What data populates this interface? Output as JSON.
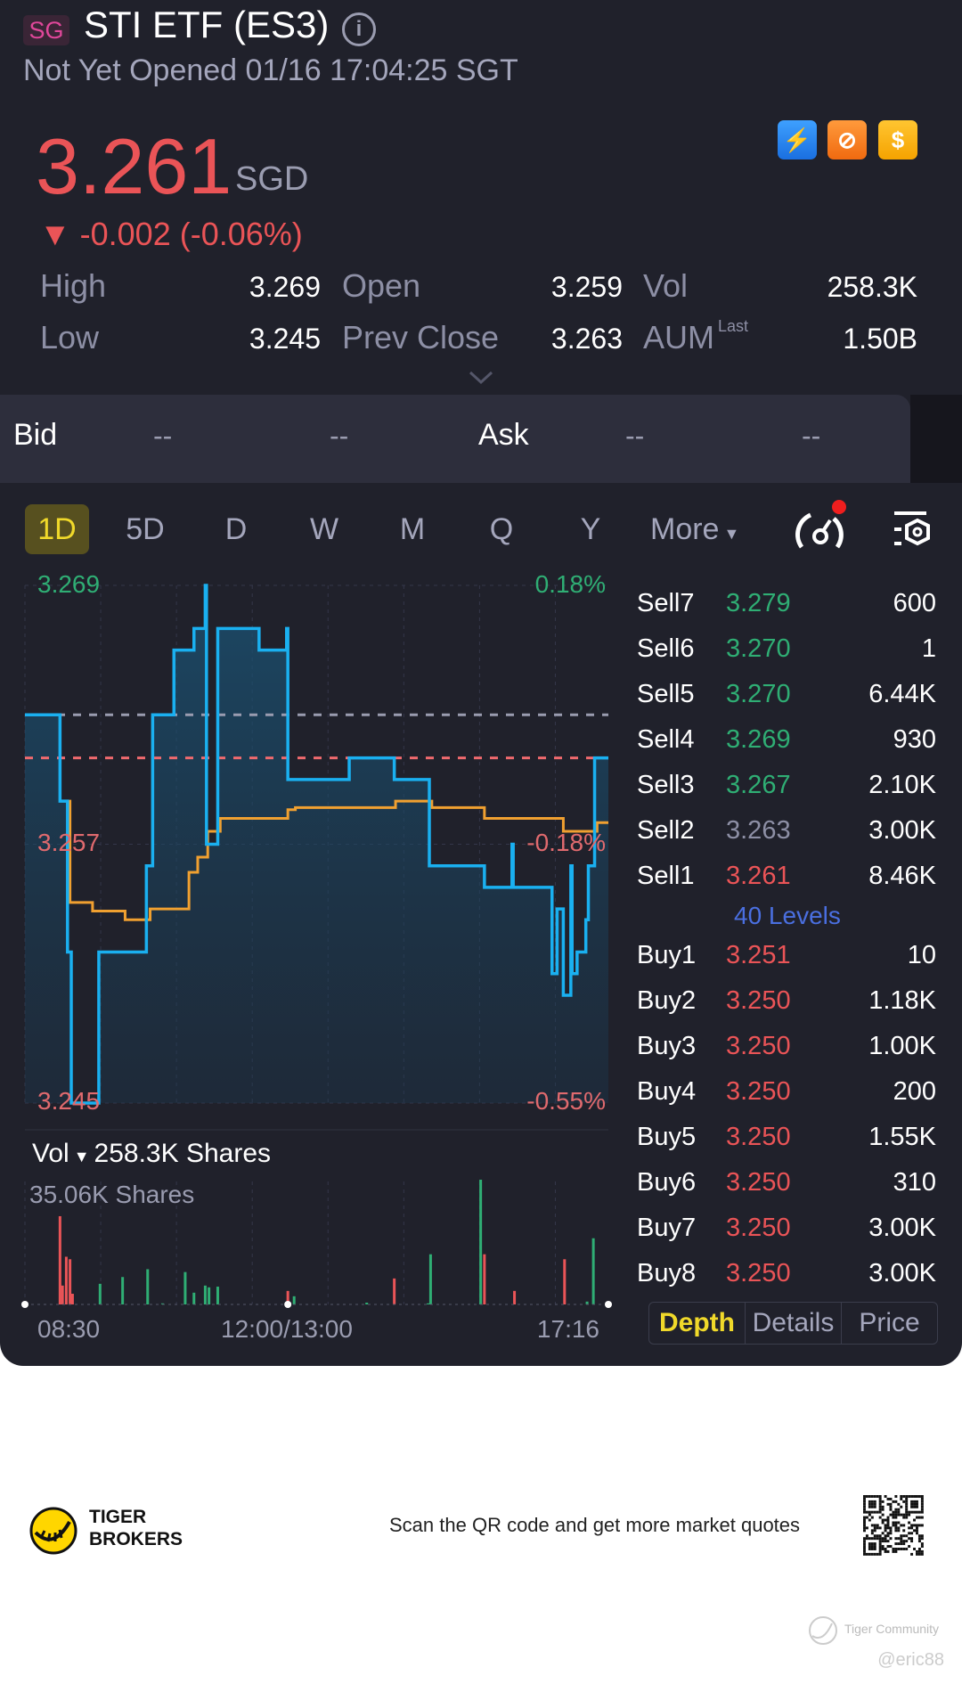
{
  "header": {
    "market_badge": "SG",
    "title": "STI ETF (ES3)",
    "info_icon": "info-icon",
    "status": "Not Yet Opened 01/16 17:04:25 SGT"
  },
  "quote": {
    "price": "3.261",
    "currency": "SGD",
    "change": "▼ -0.002 (-0.06%)",
    "feature_icons": [
      "level2-lightning-icon",
      "options-icon",
      "dollar-icon"
    ]
  },
  "stats": [
    {
      "label": "High",
      "value": "3.269"
    },
    {
      "label": "Open",
      "value": "3.259"
    },
    {
      "label": "Vol",
      "value": "258.3K"
    },
    {
      "label": "Low",
      "value": "3.245"
    },
    {
      "label": "Prev Close",
      "value": "3.263"
    },
    {
      "label": "AUM",
      "sup": "Last",
      "value": "1.50B"
    }
  ],
  "bidask": {
    "bid_label": "Bid",
    "bid_price": "--",
    "bid_size": "--",
    "ask_label": "Ask",
    "ask_price": "--",
    "ask_size": "--"
  },
  "periods": [
    "1D",
    "5D",
    "D",
    "W",
    "M",
    "Q",
    "Y",
    "More"
  ],
  "active_period": "1D",
  "colors": {
    "up": "#2fae74",
    "down": "#ea5457",
    "price_line": "#1ab0f0",
    "avg_line": "#f0a030",
    "accent": "#f0d92a"
  },
  "chart_data": {
    "type": "line",
    "ylim": [
      3.245,
      3.269
    ],
    "y_labels": {
      "top": "3.269",
      "mid": "3.257",
      "bottom": "3.245"
    },
    "pct_labels": {
      "top": "0.18%",
      "mid": "-0.18%",
      "bottom": "-0.55%"
    },
    "prev_close": 3.263,
    "last_price": 3.261,
    "x_labels": [
      "08:30",
      "12:00/13:00",
      "17:16"
    ],
    "price_series": [
      [
        "08:30",
        3.263
      ],
      [
        "08:58",
        3.259
      ],
      [
        "09:04",
        3.252
      ],
      [
        "09:07",
        3.245
      ],
      [
        "09:29",
        3.252
      ],
      [
        "10:07",
        3.256
      ],
      [
        "10:12",
        3.263
      ],
      [
        "10:29",
        3.266
      ],
      [
        "10:45",
        3.267
      ],
      [
        "10:54",
        3.269
      ],
      [
        "10:55",
        3.257
      ],
      [
        "11:04",
        3.267
      ],
      [
        "11:37",
        3.266
      ],
      [
        "11:59",
        3.267
      ],
      [
        "13:00",
        3.26
      ],
      [
        "13:49",
        3.261
      ],
      [
        "14:25",
        3.26
      ],
      [
        "14:53",
        3.256
      ],
      [
        "15:37",
        3.255
      ],
      [
        "15:59",
        3.257
      ],
      [
        "16:00",
        3.255
      ],
      [
        "16:31",
        3.251
      ],
      [
        "16:35",
        3.254
      ],
      [
        "16:40",
        3.25
      ],
      [
        "16:46",
        3.256
      ],
      [
        "16:47",
        3.251
      ],
      [
        "16:51",
        3.252
      ],
      [
        "16:58",
        3.2535
      ],
      [
        "17:00",
        3.256
      ],
      [
        "17:05",
        3.261
      ],
      [
        "17:16",
        3.261
      ]
    ],
    "avg_series": [
      [
        "08:58",
        3.259
      ],
      [
        "09:06",
        3.2543
      ],
      [
        "09:24",
        3.2539
      ],
      [
        "09:50",
        3.2535
      ],
      [
        "10:10",
        3.254
      ],
      [
        "10:41",
        3.2557
      ],
      [
        "10:48",
        3.2564
      ],
      [
        "10:56",
        3.2576
      ],
      [
        "11:06",
        3.2582
      ],
      [
        "13:00",
        3.2586
      ],
      [
        "13:06",
        3.2587
      ],
      [
        "14:26",
        3.259
      ],
      [
        "14:55",
        3.2587
      ],
      [
        "15:37",
        3.2582
      ],
      [
        "16:40",
        3.2576
      ],
      [
        "17:07",
        3.258
      ],
      [
        "17:16",
        3.258
      ]
    ],
    "volume_label": "Vol",
    "volume_total": "258.3K Shares",
    "volume_max_label": "35.06K Shares",
    "volume_max": 35.06,
    "volume_bars": [
      [
        "08:58",
        24.8,
        "down"
      ],
      [
        "09:00",
        5.3,
        "down"
      ],
      [
        "09:03",
        13.4,
        "down"
      ],
      [
        "09:06",
        12.7,
        "down"
      ],
      [
        "09:08",
        3.0,
        "down"
      ],
      [
        "09:30",
        5.8,
        "up"
      ],
      [
        "09:48",
        7.7,
        "up"
      ],
      [
        "10:08",
        9.9,
        "up"
      ],
      [
        "10:20",
        0.3,
        "up"
      ],
      [
        "10:38",
        9.1,
        "up"
      ],
      [
        "10:45",
        3.3,
        "up"
      ],
      [
        "10:54",
        5.3,
        "up"
      ],
      [
        "10:57",
        4.8,
        "up"
      ],
      [
        "11:04",
        5.0,
        "up"
      ],
      [
        "13:00",
        3.8,
        "down"
      ],
      [
        "13:05",
        2.3,
        "up"
      ],
      [
        "14:03",
        0.5,
        "up"
      ],
      [
        "14:25",
        7.3,
        "down"
      ],
      [
        "14:52",
        0.3,
        "up"
      ],
      [
        "14:54",
        14.1,
        "up"
      ],
      [
        "15:34",
        35.06,
        "up"
      ],
      [
        "15:37",
        14.1,
        "down"
      ],
      [
        "16:01",
        3.8,
        "down"
      ],
      [
        "16:41",
        12.7,
        "down"
      ],
      [
        "16:59",
        0.8,
        "up"
      ],
      [
        "17:04",
        18.6,
        "up"
      ]
    ]
  },
  "orderbook": {
    "sells": [
      {
        "label": "Sell7",
        "price": "3.279",
        "qty": "600",
        "c": "up"
      },
      {
        "label": "Sell6",
        "price": "3.270",
        "qty": "1",
        "c": "up"
      },
      {
        "label": "Sell5",
        "price": "3.270",
        "qty": "6.44K",
        "c": "up"
      },
      {
        "label": "Sell4",
        "price": "3.269",
        "qty": "930",
        "c": "up"
      },
      {
        "label": "Sell3",
        "price": "3.267",
        "qty": "2.10K",
        "c": "up"
      },
      {
        "label": "Sell2",
        "price": "3.263",
        "qty": "3.00K",
        "c": "flat"
      },
      {
        "label": "Sell1",
        "price": "3.261",
        "qty": "8.46K",
        "c": "down"
      }
    ],
    "levels_link": "40 Levels",
    "buys": [
      {
        "label": "Buy1",
        "price": "3.251",
        "qty": "10",
        "c": "down"
      },
      {
        "label": "Buy2",
        "price": "3.250",
        "qty": "1.18K",
        "c": "down"
      },
      {
        "label": "Buy3",
        "price": "3.250",
        "qty": "1.00K",
        "c": "down"
      },
      {
        "label": "Buy4",
        "price": "3.250",
        "qty": "200",
        "c": "down"
      },
      {
        "label": "Buy5",
        "price": "3.250",
        "qty": "1.55K",
        "c": "down"
      },
      {
        "label": "Buy6",
        "price": "3.250",
        "qty": "310",
        "c": "down"
      },
      {
        "label": "Buy7",
        "price": "3.250",
        "qty": "3.00K",
        "c": "down"
      },
      {
        "label": "Buy8",
        "price": "3.250",
        "qty": "3.00K",
        "c": "down"
      }
    ],
    "tabs": [
      "Depth",
      "Details",
      "Price"
    ],
    "active_tab": "Depth"
  },
  "footer": {
    "brand_line1": "TIGER",
    "brand_line2": "BROKERS",
    "cta": "Scan the QR code and get more market quotes",
    "watermark": "Tiger Community",
    "user": "@eric88"
  }
}
